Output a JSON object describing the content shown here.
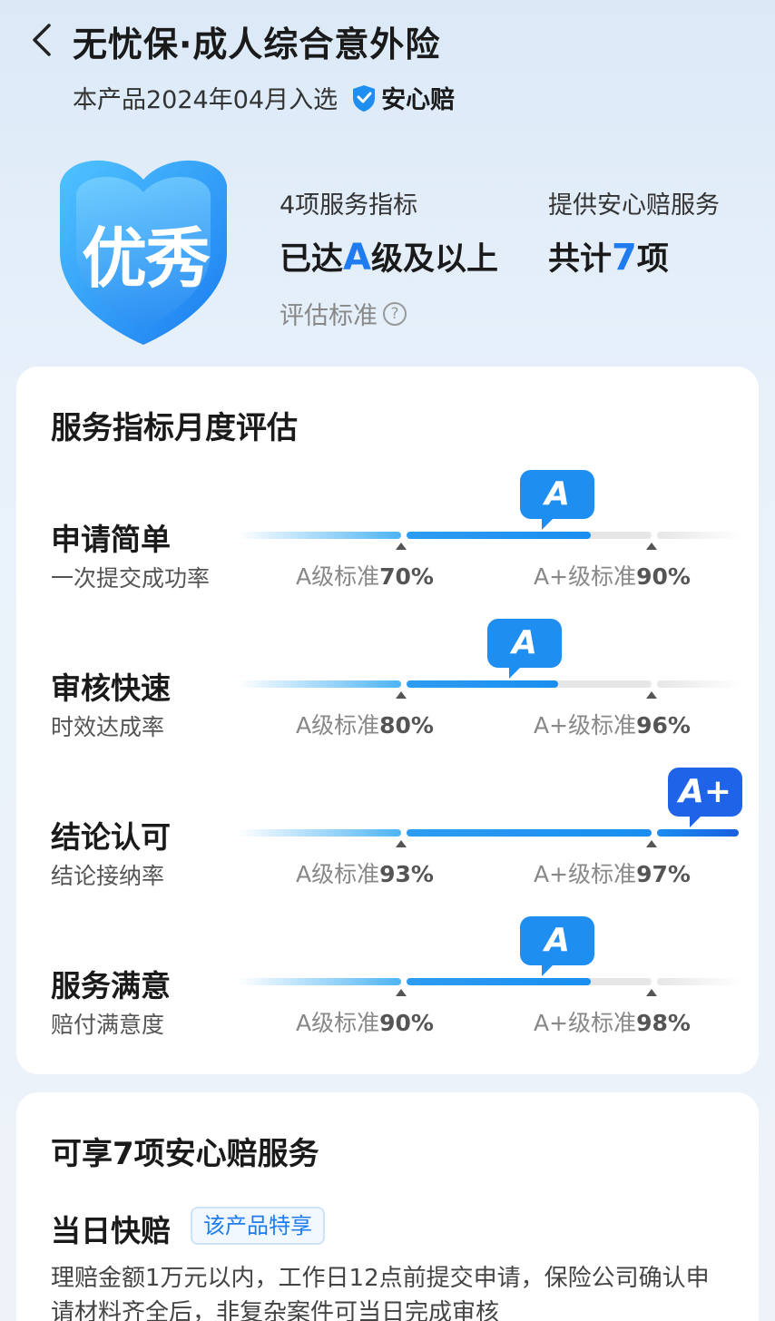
{
  "header": {
    "title": "无忧保·成人综合意外险",
    "subtitle_prefix": "本产品2024年04月入选",
    "badge_label": "安心赔"
  },
  "hero": {
    "rating": "优秀",
    "stat1_label": "4项服务指标",
    "stat1_pre": "已达",
    "stat1_hl": "A",
    "stat1_post": "级及以上",
    "stat2_label": "提供安心赔服务",
    "stat2_pre": "共计",
    "stat2_hl": "7",
    "stat2_post": "项",
    "criteria_label": "评估标准",
    "criteria_icon": "?"
  },
  "evaluation": {
    "title": "服务指标月度评估",
    "metrics": [
      {
        "name": "申请简单",
        "desc": "一次提交成功率",
        "a_label": "A级标准",
        "a_value": "70%",
        "aplus_label": "A+级标准",
        "aplus_value": "90%",
        "grade": "A",
        "progress": 0.75
      },
      {
        "name": "审核快速",
        "desc": "时效达成率",
        "a_label": "A级标准",
        "a_value": "80%",
        "aplus_label": "A+级标准",
        "aplus_value": "96%",
        "grade": "A",
        "progress": 0.62
      },
      {
        "name": "结论认可",
        "desc": "结论接纳率",
        "a_label": "A级标准",
        "a_value": "93%",
        "aplus_label": "A+级标准",
        "aplus_value": "97%",
        "grade": "A+",
        "progress": 1.0
      },
      {
        "name": "服务满意",
        "desc": "赔付满意度",
        "a_label": "A级标准",
        "a_value": "90%",
        "aplus_label": "A+级标准",
        "aplus_value": "98%",
        "grade": "A",
        "progress": 0.75
      }
    ]
  },
  "services": {
    "title": "可享7项安心赔服务",
    "item_title": "当日快赔",
    "item_tag": "该产品特享",
    "item_desc": "理赔金额1万元以内，工作日12点前提交申请，保险公司确认申请材料齐全后，非复杂案件可当日完成审核"
  },
  "colors": {
    "accent": "#1e8ef0",
    "accent_dark": "#1e63e8"
  }
}
